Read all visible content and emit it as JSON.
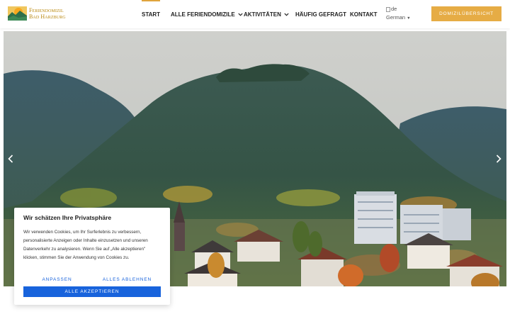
{
  "brand": {
    "line1": "Feriendomizil",
    "line2": "Bad Harzburg"
  },
  "nav": {
    "items": [
      {
        "label": "START",
        "active": true
      },
      {
        "label": "ALLE FERIENDOMIZILE",
        "dropdown": true
      },
      {
        "label": "AKTIVITÄTEN",
        "dropdown": true
      },
      {
        "label": "HÄUFIG GEFRAGT"
      },
      {
        "label": "KONTAKT"
      }
    ],
    "dropdown_icon": "chevron-down-icon"
  },
  "language": {
    "image_alt": "de",
    "label": "German",
    "caret": "▼"
  },
  "cta": {
    "label": "DOMIZILÜBERSICHT",
    "color": "#e6ac45"
  },
  "hero": {
    "prev_icon": "chevron-left-icon",
    "next_icon": "chevron-right-icon"
  },
  "cookie": {
    "title": "Wir schätzen Ihre Privatsphäre",
    "text": "Wir verwenden Cookies, um Ihr Surferlebnis zu verbessern, personalisierte Anzeigen oder Inhalte einzusetzen und unseren Datenverkehr zu analysieren. Wenn Sie auf „Alle akzeptieren\" klicken, stimmen Sie der Anwendung von Cookies zu.",
    "customize": "ANPASSEN",
    "reject": "ALLES ABLEHNEN",
    "accept": "ALLE AKZEPTIEREN",
    "accent": "#1863dc"
  }
}
